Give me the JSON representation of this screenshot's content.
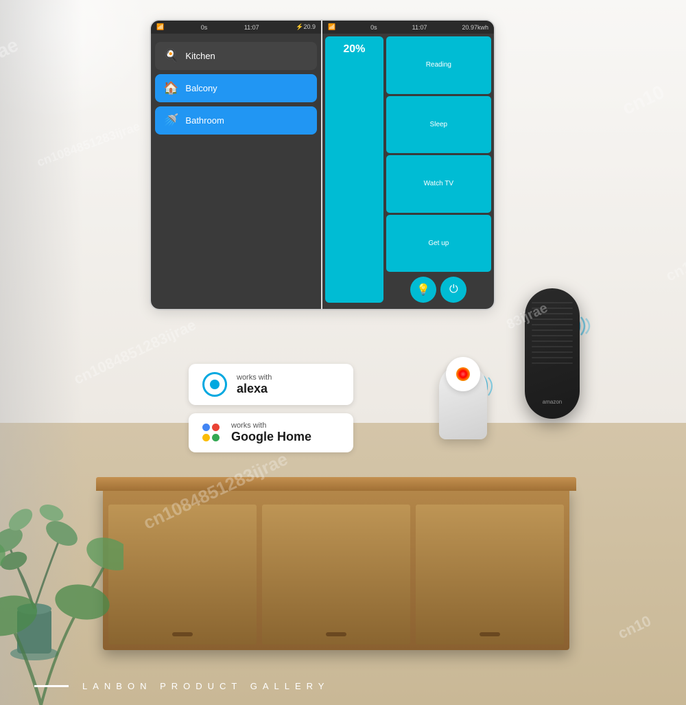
{
  "page": {
    "title": "Lanbon Product Gallery",
    "watermark": "cn1084851283ijrae"
  },
  "panel": {
    "left_screen": {
      "statusbar": {
        "wifi": "WiFi",
        "os": "0s",
        "time": "11:07",
        "energy": "20.9"
      },
      "rooms": [
        {
          "label": "Kitchen",
          "icon": "🍳",
          "active": false
        },
        {
          "label": "Balcony",
          "icon": "🏠",
          "active": true
        },
        {
          "label": "Bathroom",
          "icon": "🚿",
          "active": true
        }
      ]
    },
    "right_screen": {
      "statusbar": {
        "wifi": "WiFi",
        "os": "0s",
        "time": "11:07",
        "energy": "20.97kwh"
      },
      "dimmer_percent": "20%",
      "scenes": [
        {
          "label": "Reading"
        },
        {
          "label": "Sleep"
        },
        {
          "label": "Watch TV"
        },
        {
          "label": "Get up"
        }
      ]
    }
  },
  "badges": {
    "alexa": {
      "small_text": "works with",
      "large_text": "alexa"
    },
    "google": {
      "small_text": "works with",
      "large_text": "Google Home"
    }
  },
  "bottom": {
    "brand": "LANBON PRODUCT GALLERY"
  },
  "watermarks": [
    "cn1084851283ijrae",
    "ijrae",
    "cn10",
    "83ijrae"
  ]
}
